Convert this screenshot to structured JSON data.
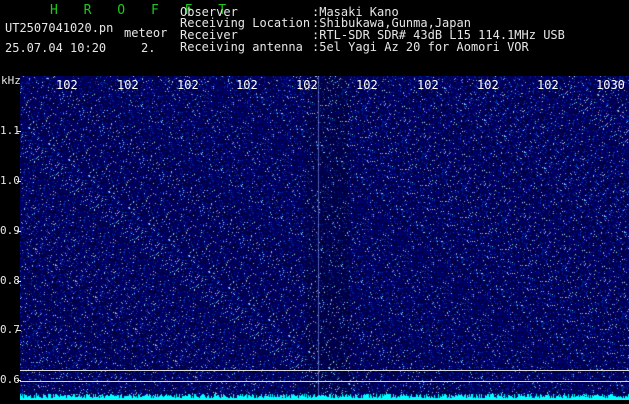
{
  "header": {
    "title": "H R O F F T",
    "filename": "UT2507041020.pn",
    "mode": "meteor",
    "timestamp": "25.07.04 10:20",
    "index": "2.",
    "meta": [
      {
        "key": "Observer",
        "value": ":Masaki Kano"
      },
      {
        "key": "Receiving Location",
        "value": ":Shibukawa,Gunma,Japan"
      },
      {
        "key": "Receiver",
        "value": ":RTL-SDR SDR# 43dB L15 114.1MHz USB"
      },
      {
        "key": "Receiving antenna",
        "value": ":5el Yagi Az 20 for Aomori VOR"
      }
    ]
  },
  "axes": {
    "y_unit": "kHz",
    "y_ticks": [
      "1.1",
      "1.0",
      "0.9",
      "0.8",
      "0.7",
      "0.6"
    ],
    "x_ticks": [
      "102",
      "102",
      "102",
      "102",
      "102",
      "102",
      "102",
      "102",
      "102",
      "1030"
    ]
  },
  "colors": {
    "title": "#1ec81e",
    "text": "#e6e6e6",
    "background": "#000000",
    "spectrum_base": "#050a5a",
    "signal_trace": "#00ffff",
    "guide_lines": "#d8d8d8"
  }
}
